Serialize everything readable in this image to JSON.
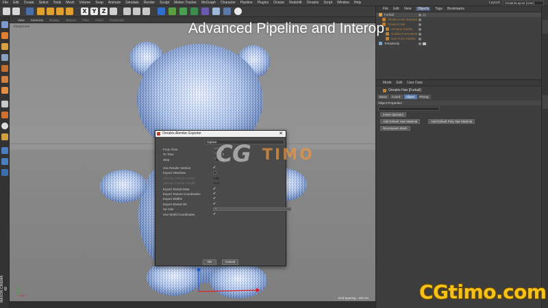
{
  "overlay": {
    "title": "Advanced Pipeline and Interop"
  },
  "menubar": {
    "items": [
      "File",
      "Edit",
      "Create",
      "Select",
      "Tools",
      "Mesh",
      "Volume",
      "Snap",
      "Animate",
      "Simulate",
      "Render",
      "Sculpt",
      "Motion Tracker",
      "MoGraph",
      "Character",
      "Pipeline",
      "Plugins",
      "Octane",
      "Redshift",
      "Ornatrix",
      "Script",
      "Window",
      "Help"
    ],
    "layout_label": "Layout:",
    "layout_value": "OrnatrixLayout (User)"
  },
  "toolbar": {
    "axis_x": "X",
    "axis_y": "Y",
    "axis_z": "Z"
  },
  "viewport": {
    "menu": [
      "View",
      "Cameras",
      "Display",
      "Options",
      "Filter",
      "Panel",
      "ProRender"
    ],
    "label": "Perspective",
    "grid_spacing": "Grid Spacing : 100 cm"
  },
  "object_manager": {
    "menu": [
      "File",
      "Edit",
      "View",
      "Objects",
      "Tags",
      "Bookmarks"
    ],
    "active_menu": "Objects",
    "objects": [
      {
        "name": "Furball",
        "color": "#e0a040"
      },
      {
        "name": "Ornatrix Hair Material",
        "color": "#c08030"
      },
      {
        "name": "Ornatrix Hair",
        "color": "#c08030"
      },
      {
        "name": "Ornatrix Guides",
        "color": "#c08030"
      },
      {
        "name": "Guides From Mesh",
        "color": "#c08030"
      },
      {
        "name": "Hair From Guides",
        "color": "#c08030"
      },
      {
        "name": "TeddyBody",
        "color": "#7aa8d8"
      }
    ]
  },
  "attribute_manager": {
    "menu": [
      "Mode",
      "Edit",
      "User Data"
    ],
    "title": "Ornatrix Hair [Furball]",
    "tabs": [
      "Basic",
      "Coord.",
      "Object",
      "Phong"
    ],
    "active_tab": "Object",
    "section": "Object Properties",
    "buttons": {
      "insert_operator": "Insert Operator",
      "add_hair_material": "Add Default Hair Material",
      "add_poly_material": "Add Default Poly Hair Material",
      "recompute_stack": "Recompute Stack"
    }
  },
  "dialog": {
    "title": "Ornatrix Alembic Exporter",
    "format": "Ogawa",
    "rows": [
      {
        "label": "From Time",
        "kind": "value",
        "value": "0 F",
        "enabled": true
      },
      {
        "label": "To Time",
        "kind": "value",
        "value": "0 F",
        "enabled": true
      },
      {
        "label": "Step",
        "kind": "value",
        "value": "1",
        "enabled": true
      },
      {
        "label": "Use Render Version",
        "kind": "check",
        "checked": true,
        "enabled": true
      },
      {
        "label": "Export Velocities",
        "kind": "check",
        "checked": false,
        "enabled": true
      },
      {
        "label": "Velocity Interval Center",
        "kind": "value",
        "value": "0",
        "enabled": false
      },
      {
        "label": "Velocity Interval Length",
        "kind": "value",
        "value": "0.5",
        "enabled": false
      },
      {
        "label": "Export Strand Data",
        "kind": "check",
        "checked": true,
        "enabled": true
      },
      {
        "label": "Export Texture Coordinates",
        "kind": "check",
        "checked": true,
        "enabled": true
      },
      {
        "label": "Export Widths",
        "kind": "check",
        "checked": true,
        "enabled": true
      },
      {
        "label": "Export Strand Ids",
        "kind": "check",
        "checked": true,
        "enabled": true
      },
      {
        "label": "Up Axis",
        "kind": "select",
        "value": "Y",
        "enabled": true
      },
      {
        "label": "Use World Coordinates",
        "kind": "check",
        "checked": true,
        "enabled": true
      }
    ],
    "ok_label": "OK",
    "cancel_label": "Cancel",
    "check_glyph": "✔",
    "close_glyph": "✕",
    "spin_glyph": "⬍"
  },
  "watermarks": {
    "center_logo": "CG",
    "center_text": "TIMO",
    "corner": "CGtimo.com"
  },
  "side_brand": "MAXON CINEMA 4D"
}
